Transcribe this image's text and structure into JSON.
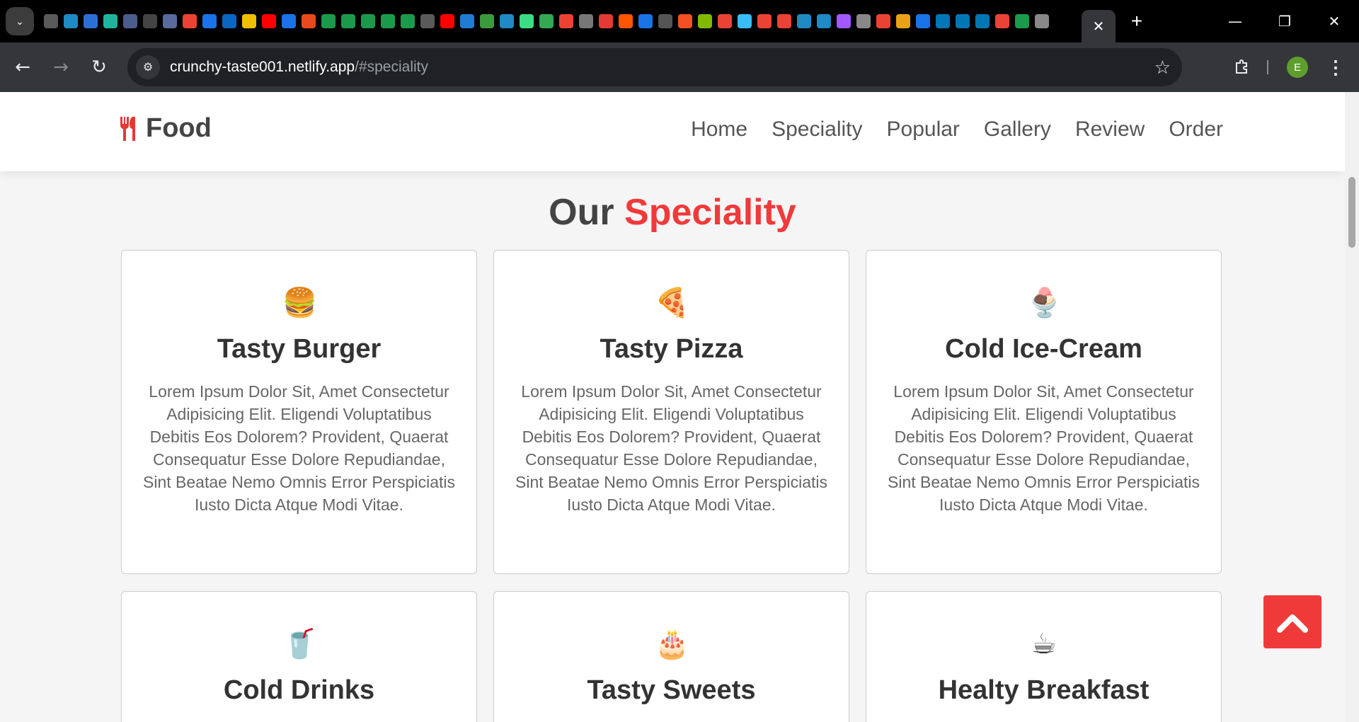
{
  "browser": {
    "tab_search_icon": "chevron-down-icon",
    "active_tab_close": "✕",
    "new_tab": "+",
    "window": {
      "minimize": "—",
      "restore": "❐",
      "close": "✕"
    },
    "favicons": [
      {
        "icon": "github-icon",
        "color": "#5a5a5a"
      },
      {
        "icon": "react-icon",
        "color": "#1f8ac4"
      },
      {
        "icon": "arrow-icon",
        "color": "#2b6fd6"
      },
      {
        "icon": "diamond-icon",
        "color": "#1fb59c"
      },
      {
        "icon": "image-icon",
        "color": "#4a5d8c"
      },
      {
        "icon": "openai-icon",
        "color": "#444"
      },
      {
        "icon": "image-icon",
        "color": "#5a6a9c"
      },
      {
        "icon": "google-icon",
        "color": "#ea4335"
      },
      {
        "icon": "translate-icon",
        "color": "#1a73e8"
      },
      {
        "icon": "linkedin-icon",
        "color": "#0a66c2"
      },
      {
        "icon": "ex-icon",
        "color": "#f0c000"
      },
      {
        "icon": "youtube-icon",
        "color": "#ff0000"
      },
      {
        "icon": "check-icon",
        "color": "#1a73e8"
      },
      {
        "icon": "udemy-icon",
        "color": "#e84a1e"
      },
      {
        "icon": "w-icon",
        "color": "#1c9a4c"
      },
      {
        "icon": "w-icon",
        "color": "#1c9a4c"
      },
      {
        "icon": "w-icon",
        "color": "#1c9a4c"
      },
      {
        "icon": "w-icon",
        "color": "#1c9a4c"
      },
      {
        "icon": "w-icon",
        "color": "#1c9a4c"
      },
      {
        "icon": "github-icon",
        "color": "#5a5a5a"
      },
      {
        "icon": "youtube-icon",
        "color": "#ff0000"
      },
      {
        "icon": "vscode-icon",
        "color": "#1f7ad4"
      },
      {
        "icon": "node-icon",
        "color": "#3c9a3c"
      },
      {
        "icon": "react-icon",
        "color": "#1f8ac4"
      },
      {
        "icon": "android-icon",
        "color": "#3ddc84"
      },
      {
        "icon": "code-icon",
        "color": "#34a853"
      },
      {
        "icon": "google-icon",
        "color": "#ea4335"
      },
      {
        "icon": "download-icon",
        "color": "#777"
      },
      {
        "icon": "app-icon",
        "color": "#e53935"
      },
      {
        "icon": "soundcloud-icon",
        "color": "#ff5500"
      },
      {
        "icon": "translate-icon",
        "color": "#1a73e8"
      },
      {
        "icon": "xfs-icon",
        "color": "#555"
      },
      {
        "icon": "microsoft-icon",
        "color": "#f25022"
      },
      {
        "icon": "microsoft-icon",
        "color": "#7fba00"
      },
      {
        "icon": "google-icon",
        "color": "#ea4335"
      },
      {
        "icon": "wave-icon",
        "color": "#38bdf8"
      },
      {
        "icon": "google-icon",
        "color": "#ea4335"
      },
      {
        "icon": "google-icon",
        "color": "#ea4335"
      },
      {
        "icon": "react-icon",
        "color": "#1f8ac4"
      },
      {
        "icon": "react-icon",
        "color": "#1f8ac4"
      },
      {
        "icon": "figma-icon",
        "color": "#a259ff"
      },
      {
        "icon": "chrome-icon",
        "color": "#888"
      },
      {
        "icon": "google-icon",
        "color": "#ea4335"
      },
      {
        "icon": "trophy-icon",
        "color": "#e8a317"
      },
      {
        "icon": "f-icon",
        "color": "#1a73e8"
      },
      {
        "icon": "p-icon",
        "color": "#0077b5"
      },
      {
        "icon": "p-icon",
        "color": "#0077b5"
      },
      {
        "icon": "p-icon",
        "color": "#0077b5"
      },
      {
        "icon": "google-icon",
        "color": "#ea4335"
      },
      {
        "icon": "w-icon",
        "color": "#1c9a4c"
      },
      {
        "icon": "chrome-icon",
        "color": "#888"
      }
    ],
    "url_host": "crunchy-taste001.netlify.app",
    "url_path": "/#speciality",
    "profile_initial": "E"
  },
  "site": {
    "logo_text": "Food",
    "nav": [
      "Home",
      "Speciality",
      "Popular",
      "Gallery",
      "Review",
      "Order"
    ],
    "heading_main": "Our",
    "heading_accent": "Speciality",
    "cards": [
      {
        "title": "Tasty Burger",
        "icon": "burger-icon",
        "glyph": "🍔",
        "text": "Lorem Ipsum Dolor Sit, Amet Consectetur Adipisicing Elit. Eligendi Voluptatibus Debitis Eos Dolorem? Provident, Quaerat Consequatur Esse Dolore Repudiandae, Sint Beatae Nemo Omnis Error Perspiciatis Iusto Dicta Atque Modi Vitae."
      },
      {
        "title": "Tasty Pizza",
        "icon": "pizza-icon",
        "glyph": "🍕",
        "text": "Lorem Ipsum Dolor Sit, Amet Consectetur Adipisicing Elit. Eligendi Voluptatibus Debitis Eos Dolorem? Provident, Quaerat Consequatur Esse Dolore Repudiandae, Sint Beatae Nemo Omnis Error Perspiciatis Iusto Dicta Atque Modi Vitae."
      },
      {
        "title": "Cold Ice-Cream",
        "icon": "ice-cream-icon",
        "glyph": "🍨",
        "text": "Lorem Ipsum Dolor Sit, Amet Consectetur Adipisicing Elit. Eligendi Voluptatibus Debitis Eos Dolorem? Provident, Quaerat Consequatur Esse Dolore Repudiandae, Sint Beatae Nemo Omnis Error Perspiciatis Iusto Dicta Atque Modi Vitae."
      },
      {
        "title": "Cold Drinks",
        "icon": "drink-icon",
        "glyph": "🥤",
        "text": ""
      },
      {
        "title": "Tasty Sweets",
        "icon": "cake-icon",
        "glyph": "🎂",
        "text": ""
      },
      {
        "title": "Healty Breakfast",
        "icon": "coffee-icon",
        "glyph": "☕",
        "text": ""
      }
    ]
  },
  "colors": {
    "accent": "#f03a3a",
    "logo_icon": "#e53935",
    "page_bg": "#f5f5f5"
  }
}
